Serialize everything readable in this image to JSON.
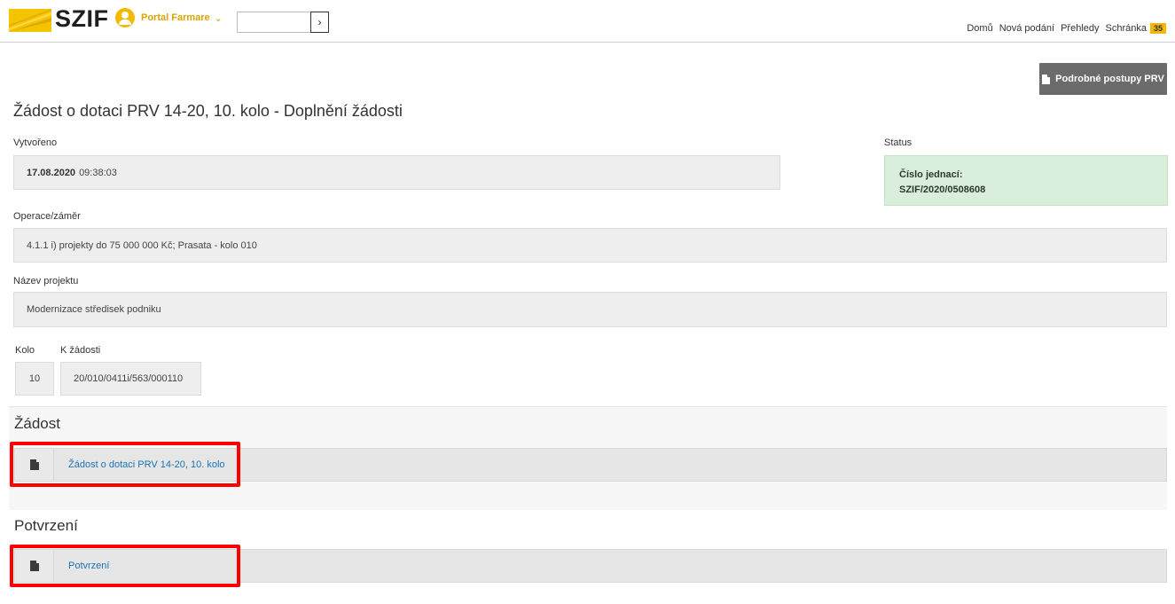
{
  "header": {
    "logo_text": "SZIF",
    "portal_label": "Portal Farmare",
    "nav": [
      "Domů",
      "Nová podání",
      "Přehledy",
      "Schránka"
    ],
    "inbox_count": "35"
  },
  "actions": {
    "procedures_button": "Podrobné postupy PRV"
  },
  "page": {
    "title": "Žádost o dotaci PRV 14-20, 10. kolo - Doplnění žádosti",
    "created_label": "Vytvořeno",
    "created_date": "17.08.2020",
    "created_time": "09:38:03",
    "status_label": "Status",
    "status_line1": "Číslo jednací:",
    "status_line2": "SZIF/2020/0508608",
    "operation_label": "Operace/záměr",
    "operation_value": "4.1.1 i) projekty do 75 000 000 Kč; Prasata - kolo 010",
    "project_label": "Název projektu",
    "project_value": "Modernizace středisek podniku",
    "round_label": "Kolo",
    "round_value": "10",
    "request_label": "K žádosti",
    "request_value": "20/010/0411i/563/000110"
  },
  "sections": {
    "request_title": "Žádost",
    "request_doc": "Žádost o dotaci PRV 14-20, 10. kolo",
    "confirmation_title": "Potvrzení",
    "confirmation_doc": "Potvrzení"
  },
  "colors": {
    "accent_yellow": "#f3b800",
    "link_blue": "#1a73b5",
    "status_green": "#d9efdc",
    "highlight_red": "#ff0000"
  }
}
